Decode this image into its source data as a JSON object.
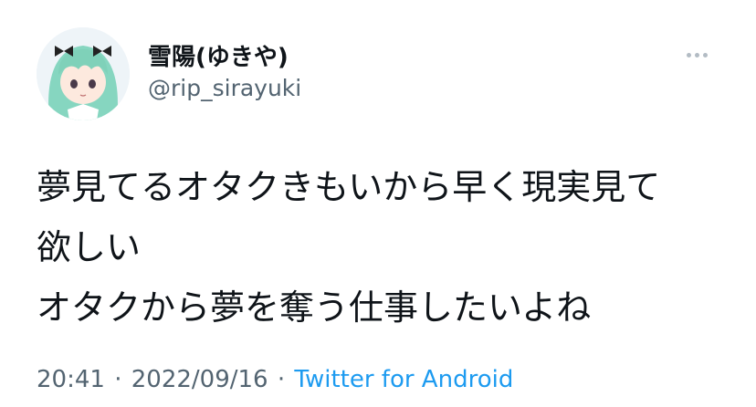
{
  "user": {
    "display_name": "雪陽(ゆきや)",
    "handle": "@rip_sirayuki"
  },
  "tweet": {
    "lines": [
      "夢見てるオタクきもいから早く現実見て",
      "欲しい",
      "オタクから夢を奪う仕事したいよね"
    ]
  },
  "meta": {
    "time": "20:41",
    "separator": "·",
    "date": "2022/09/16",
    "source": "Twitter for Android"
  },
  "icons": {
    "more": "more-options-icon",
    "avatar": "anime-girl-avatar"
  },
  "colors": {
    "text": "#0f1419",
    "secondary": "#536471",
    "link": "#1d9bf0",
    "avatar_hair": "#7fd1b9"
  }
}
